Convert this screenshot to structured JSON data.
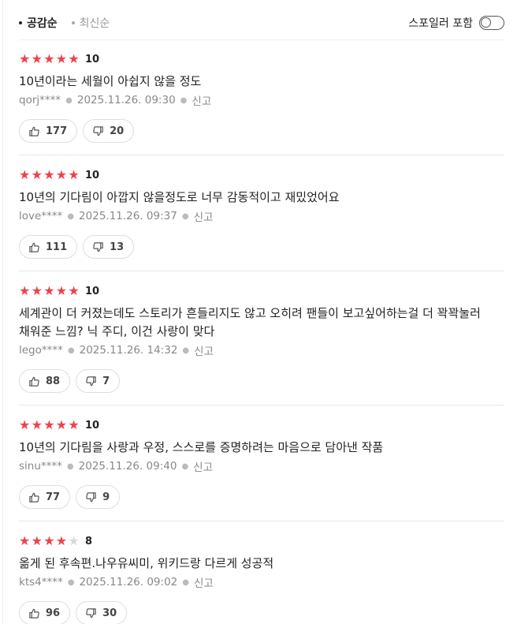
{
  "sort": {
    "tabs": [
      {
        "label": "공감순",
        "active": true
      },
      {
        "label": "최신순",
        "active": false
      }
    ]
  },
  "spoiler": {
    "label": "스포일러 포함",
    "on": false
  },
  "reviews": [
    {
      "stars": 5,
      "score": "10",
      "text": "10년이라는 세월이 아쉽지 않을 정도",
      "user": "qorj****",
      "date": "2025.11.26. 09:30",
      "report": "신고",
      "likes": "177",
      "dislikes": "20"
    },
    {
      "stars": 5,
      "score": "10",
      "text": "10년의 기다림이 아깝지 않을정도로 너무 감동적이고 재밌었어요",
      "user": "love****",
      "date": "2025.11.26. 09:37",
      "report": "신고",
      "likes": "111",
      "dislikes": "13"
    },
    {
      "stars": 5,
      "score": "10",
      "text": "세계관이 더 커졌는데도 스토리가 흔들리지도 않고 오히려 팬들이 보고싶어하는걸 더 꽉꽉눌러 채워준 느낌? 닉 주디, 이건 사랑이 맞다",
      "user": "lego****",
      "date": "2025.11.26. 14:32",
      "report": "신고",
      "likes": "88",
      "dislikes": "7"
    },
    {
      "stars": 5,
      "score": "10",
      "text": "10년의 기다림을 사랑과 우정, 스스로를 증명하려는 마음으로 담아낸 작품",
      "user": "sinu****",
      "date": "2025.11.26. 09:40",
      "report": "신고",
      "likes": "77",
      "dislikes": "9"
    },
    {
      "stars": 4,
      "score": "8",
      "text": "옮게 된 후속편.나우유씨미, 위키드랑 다르게 성공적",
      "user": "kts4****",
      "date": "2025.11.26. 09:02",
      "report": "신고",
      "likes": "96",
      "dislikes": "30"
    }
  ]
}
